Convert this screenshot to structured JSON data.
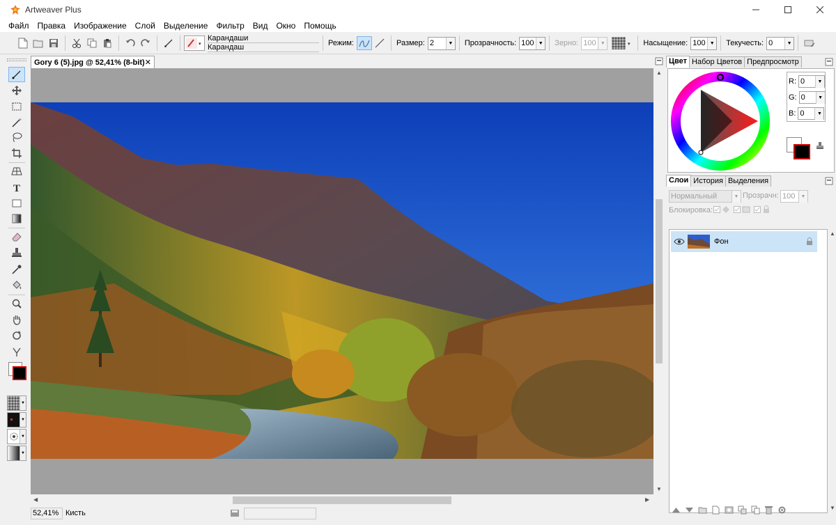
{
  "app": {
    "title": "Artweaver Plus"
  },
  "menu": [
    "Файл",
    "Правка",
    "Изображение",
    "Слой",
    "Выделение",
    "Фильтр",
    "Вид",
    "Окно",
    "Помощь"
  ],
  "toolbar": {
    "brush_category": "Карандаши",
    "brush_name": "Карандаш",
    "mode_label": "Режим:",
    "size_label": "Размер:",
    "size_value": "2",
    "opacity_label": "Прозрачность:",
    "opacity_value": "100",
    "grain_label": "Зерно:",
    "grain_value": "100",
    "saturation_label": "Насыщение:",
    "saturation_value": "100",
    "flow_label": "Текучесть:",
    "flow_value": "0"
  },
  "document": {
    "tab_title": "Gory 6 (5).jpg @ 52,41% (8-bit)",
    "close_glyph": "✕"
  },
  "status": {
    "zoom": "52,41%",
    "tool": "Кисть"
  },
  "color_panel": {
    "tabs": [
      "Цвет",
      "Набор Цветов",
      "Предпросмотр"
    ],
    "r_label": "R:",
    "r_value": "0",
    "g_label": "G:",
    "g_value": "0",
    "b_label": "B:",
    "b_value": "0",
    "foreground": "#000000",
    "background": "#ffffff"
  },
  "layers_panel": {
    "tabs": [
      "Слои",
      "История",
      "Выделения"
    ],
    "blend_mode": "Нормальный",
    "opacity_label": "Прозрачн:",
    "opacity_value": "100",
    "lock_label": "Блокировка:",
    "layers": [
      {
        "name": "Фон"
      }
    ]
  },
  "colors": {
    "selection": "#cce4f7",
    "selection_border": "#7eb4ea",
    "canvas_bg": "#a0a0a0"
  },
  "icons": {
    "tools": [
      "brush-icon",
      "move-icon",
      "rect-select-icon",
      "magic-wand-icon",
      "lasso-icon",
      "crop-icon",
      "perspective-icon",
      "text-icon",
      "shape-icon",
      "gradient-icon",
      "eraser-icon",
      "clone-stamp-icon",
      "eyedropper-icon",
      "fill-bucket-icon",
      "zoom-icon",
      "hand-icon",
      "rotate-icon",
      "smudge-icon"
    ]
  }
}
